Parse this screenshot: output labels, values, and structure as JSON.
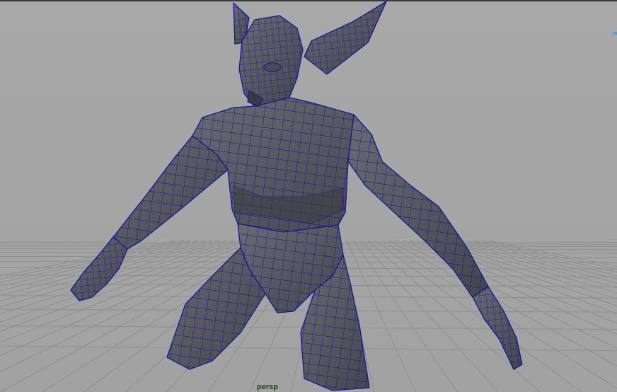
{
  "viewport": {
    "camera_label": "persp",
    "background_color": "#a6a6a6",
    "grid_color": "#8e8e8e",
    "grid_line_color": "#9a9a9a",
    "mesh_fill_color": "#5a5a61",
    "mesh_shade_color": "#3f3f45",
    "wire_color": "#0e0e9a"
  },
  "icons": {
    "manipulator": "view-manipulator-icon"
  }
}
